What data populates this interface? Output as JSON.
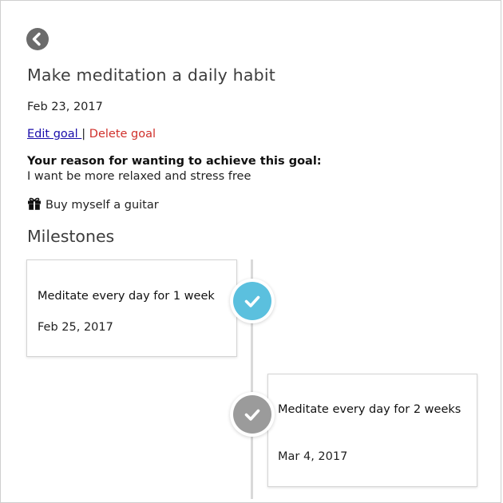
{
  "goal": {
    "title": "Make meditation a daily habit",
    "date": "Feb 23, 2017",
    "edit_label": "Edit goal ",
    "separator": "|",
    "delete_label": " Delete goal",
    "reason_label": "Your reason for wanting to achieve this goal:",
    "reason_text": "I want be more relaxed and stress free",
    "reward_icon": "gift-icon",
    "reward_text": "Buy myself a guitar"
  },
  "back_icon": "chevron-left-icon",
  "milestones": {
    "heading": "Milestones",
    "items": [
      {
        "title": "Meditate every day for 1 week",
        "date": "Feb 25, 2017",
        "status": "completed",
        "color": "#5bc0de"
      },
      {
        "title": "Meditate every day for 2 weeks",
        "date": "Mar 4, 2017",
        "status": "pending",
        "color": "#9b9b9b"
      }
    ]
  },
  "colors": {
    "accent": "#5bc0de",
    "delete": "#d0302b",
    "link": "#1a0dab"
  }
}
